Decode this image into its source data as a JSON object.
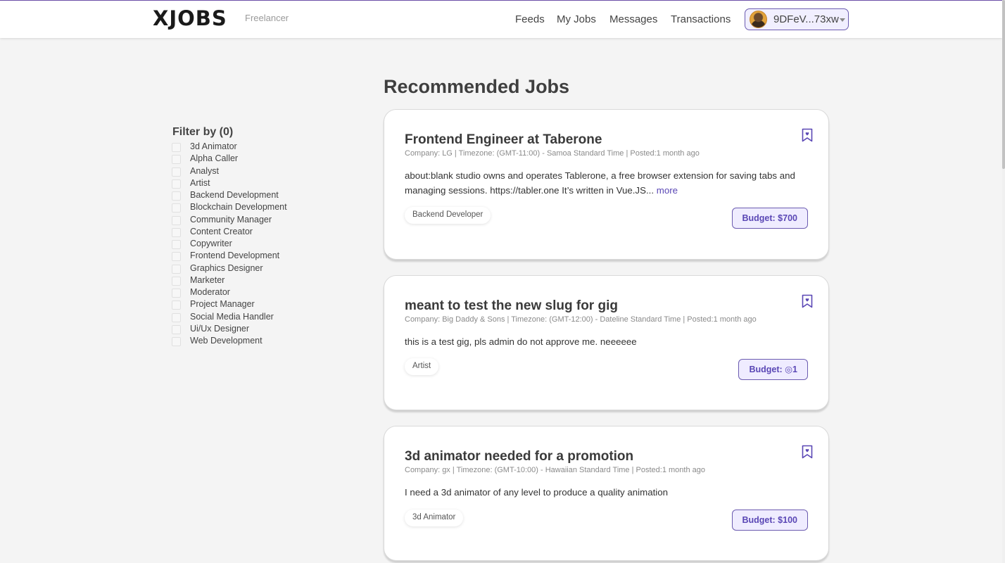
{
  "header": {
    "brand": "XJOBS",
    "brand_sub": "Freelancer",
    "nav": [
      "Feeds",
      "My Jobs",
      "Messages",
      "Transactions"
    ],
    "wallet_address": "9DFeV...73xw"
  },
  "filter": {
    "title": "Filter by (0)",
    "items": [
      "3d Animator",
      "Alpha Caller",
      "Analyst",
      "Artist",
      "Backend Development",
      "Blockchain Development",
      "Community Manager",
      "Content Creator",
      "Copywriter",
      "Frontend Development",
      "Graphics Designer",
      "Marketer",
      "Moderator",
      "Project Manager",
      "Social Media Handler",
      "Ui/Ux Designer",
      "Web Development"
    ]
  },
  "main": {
    "title": "Recommended Jobs",
    "jobs": [
      {
        "title": "Frontend Engineer at Taberone",
        "meta": "Company: LG | Timezone: (GMT-11:00) - Samoa Standard Time | Posted:1 month ago",
        "description": "about:blank studio owns and operates Tablerone, a free browser extension for saving tabs and managing sessions. https://tabler.one It’s written in Vue.JS...",
        "more": "more",
        "tag": "Backend Developer",
        "budget": "Budget: $700"
      },
      {
        "title": "meant to test the new slug for gig",
        "meta": "Company: Big Daddy & Sons | Timezone: (GMT-12:00) - Dateline Standard Time | Posted:1 month ago",
        "description": "this is a test gig, pls admin do not approve me. neeeeee",
        "more": "",
        "tag": "Artist",
        "budget": "Budget: ◎1"
      },
      {
        "title": "3d animator needed for a promotion",
        "meta": "Company: gx | Timezone: (GMT-10:00) - Hawaiian Standard Time | Posted:1 month ago",
        "description": "I need a 3d animator of any level to produce a quality animation",
        "more": "",
        "tag": "3d Animator",
        "budget": "Budget: $100"
      }
    ]
  },
  "colors": {
    "accent": "#5a47b5",
    "budget_bg": "#efecff",
    "page_bg": "#f4f4f4"
  },
  "icons": {
    "bookmark": "bookmark-heart-icon",
    "wallet_caret": "chevron-down-icon"
  }
}
